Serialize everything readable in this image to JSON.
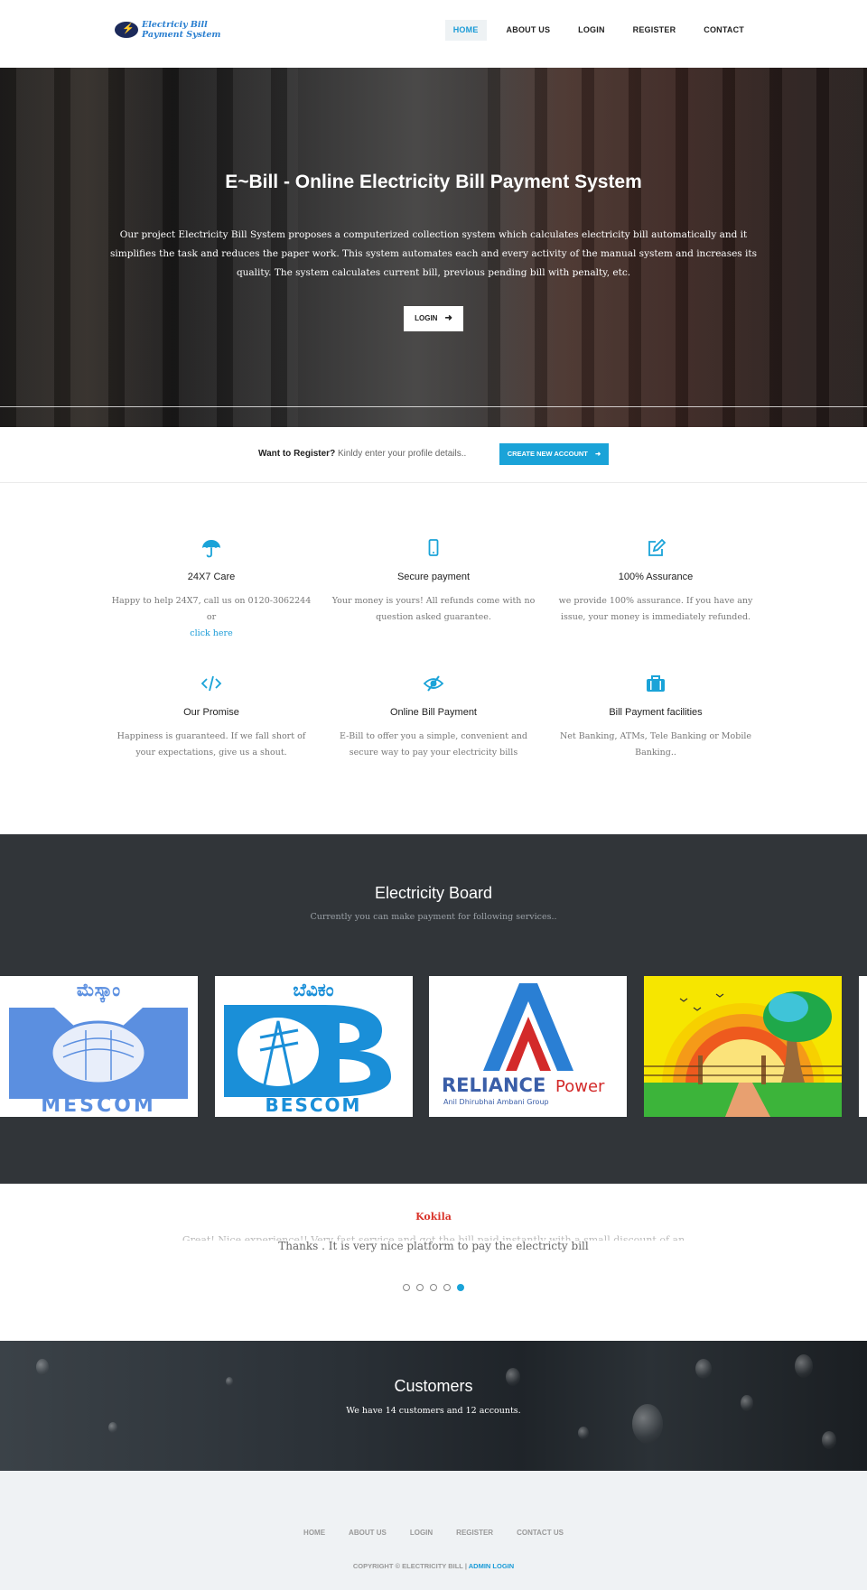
{
  "header": {
    "logo_line1": "Electriciy Bill",
    "logo_line2": "Payment System",
    "nav": [
      {
        "label": "HOME",
        "active": true
      },
      {
        "label": "ABOUT US"
      },
      {
        "label": "LOGIN"
      },
      {
        "label": "REGISTER"
      },
      {
        "label": "CONTACT"
      }
    ]
  },
  "hero": {
    "title": "E~Bill - Online Electricity Bill Payment System",
    "description": "Our project Electricity Bill System proposes a computerized collection system which calculates electricity bill automatically and it simplifies the task and reduces the paper work. This system automates each and every activity of the manual system and increases its quality. The system calculates current bill, previous pending bill with penalty, etc.",
    "button_label": "LOGIN"
  },
  "register": {
    "prompt": "Want to Register?",
    "sub": "Kinldy enter your profile details..",
    "button_label": "CREATE NEW ACCOUNT"
  },
  "features": [
    {
      "icon": "umbrella-icon",
      "title": "24X7 Care",
      "desc": "Happy to help 24X7, call us on 0120-3062244 or",
      "link": "click here"
    },
    {
      "icon": "mobile-icon",
      "title": "Secure payment",
      "desc": "Your money is yours! All refunds come with no question asked guarantee."
    },
    {
      "icon": "edit-icon",
      "title": "100% Assurance",
      "desc": "we provide 100% assurance. If you have any issue, your money is immediately refunded."
    },
    {
      "icon": "code-icon",
      "title": "Our Promise",
      "desc": "Happiness is guaranteed. If we fall short of your expectations, give us a shout."
    },
    {
      "icon": "eye-slash-icon",
      "title": "Online Bill Payment",
      "desc": "E-Bill to offer you a simple, convenient and secure way to pay your electricity bills"
    },
    {
      "icon": "briefcase-icon",
      "title": "Bill Payment facilities",
      "desc": "Net Banking, ATMs, Tele Banking or Mobile Banking.."
    }
  ],
  "board": {
    "title": "Electricity Board",
    "subtitle": "Currently you can make payment for following services..",
    "logos": [
      {
        "name": "MESCOM",
        "script": "ಮೆಸ್ಕಾಂ"
      },
      {
        "name": "BESCOM",
        "script": "ಬೆವಿಕಂ"
      },
      {
        "name": "RELIANCE",
        "name2": "Power",
        "tagline": "Anil Dhirubhai Ambani Group"
      },
      {
        "name": "sunset-tree-illustration"
      }
    ],
    "colors": {
      "mescom": "#5b8fe0",
      "bescom": "#1a8fd8",
      "reliance_blue": "#2a7fd4",
      "reliance_red": "#d32a2a"
    }
  },
  "testimonial": {
    "name": "Kokila",
    "ghost_text": "Great! Nice experience!! Very fast service and got the bill paid instantly with a small discount of an affordable",
    "text": "Thanks . It is very nice platform to pay the electricty bill",
    "dots": 5,
    "active_dot": 5
  },
  "customers": {
    "title": "Customers",
    "text": "We have 14 customers and 12 accounts."
  },
  "footer": {
    "links": [
      "HOME",
      "ABOUT US",
      "LOGIN",
      "REGISTER",
      "CONTACT US"
    ],
    "copyright": "COPYRIGHT © ELECTRICITY BILL |",
    "admin_link": "ADMIN LOGIN"
  },
  "accent_color": "#1aa3d8"
}
